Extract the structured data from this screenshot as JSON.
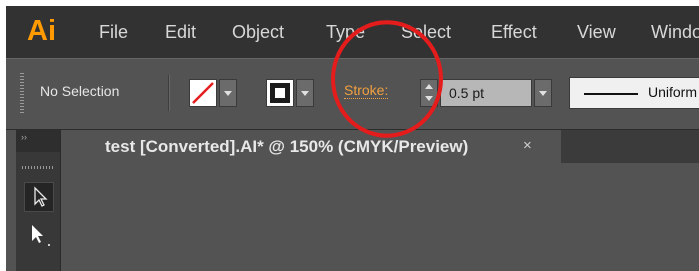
{
  "app": {
    "logo_text": "Ai",
    "brand_color": "#ff9a00"
  },
  "menu": {
    "items": [
      "File",
      "Edit",
      "Object",
      "Type",
      "Select",
      "Effect",
      "View",
      "Window"
    ]
  },
  "control_bar": {
    "selection_label": "No Selection",
    "stroke_label": "Stroke:",
    "stroke_weight": "0.5 pt",
    "variable_width_profile": "Uniform"
  },
  "document_tab": {
    "title": "test [Converted].AI* @ 150% (CMYK/Preview)",
    "close_glyph": "×"
  },
  "tools_panel": {
    "collapse_glyph": "››",
    "tools": [
      "selection-tool",
      "direct-selection-tool"
    ]
  },
  "annotation": {
    "color": "#e41c1c"
  }
}
